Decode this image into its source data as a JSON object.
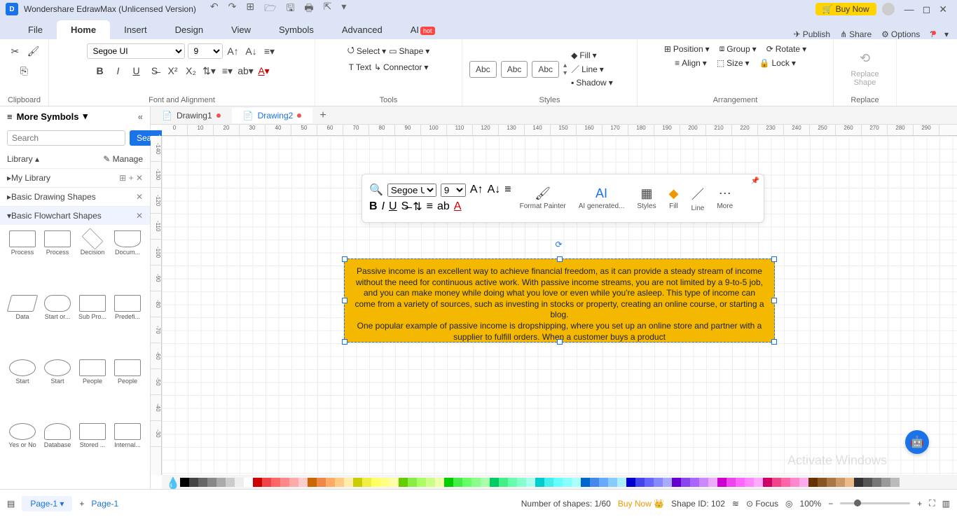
{
  "title": "Wondershare EdrawMax (Unlicensed Version)",
  "buyNow": "Buy Now",
  "menuTabs": [
    "File",
    "Home",
    "Insert",
    "Design",
    "View",
    "Symbols",
    "Advanced",
    "AI"
  ],
  "menuRight": {
    "publish": "Publish",
    "share": "Share",
    "options": "Options"
  },
  "ribbon": {
    "clipboard": "Clipboard",
    "fontAlign": "Font and Alignment",
    "tools": "Tools",
    "styles": "Styles",
    "arrangement": "Arrangement",
    "replace": "Replace",
    "font": "Segoe UI",
    "size": "9",
    "select": "Select",
    "shape": "Shape",
    "text": "Text",
    "connector": "Connector",
    "abc": "Abc",
    "fill": "Fill",
    "line": "Line",
    "shadow": "Shadow",
    "position": "Position",
    "group": "Group",
    "rotate": "Rotate",
    "align": "Align",
    "sizeBtn": "Size",
    "lock": "Lock",
    "replaceShape": "Replace\nShape"
  },
  "leftPanel": {
    "moreSymbols": "More Symbols",
    "searchPlaceholder": "Search",
    "searchBtn": "Search",
    "library": "Library",
    "manage": "Manage",
    "myLibrary": "My Library",
    "basicDrawing": "Basic Drawing Shapes",
    "basicFlowchart": "Basic Flowchart Shapes",
    "shapes": [
      "Process",
      "Process",
      "Decision",
      "Docum...",
      "Data",
      "Start or...",
      "Sub Pro...",
      "Predefi...",
      "Start",
      "Start",
      "People",
      "People",
      "Yes or No",
      "Database",
      "Stored ...",
      "Internal..."
    ]
  },
  "docTabs": {
    "d1": "Drawing1",
    "d2": "Drawing2"
  },
  "hruler": [
    0,
    10,
    20,
    30,
    40,
    50,
    60,
    70,
    80,
    90,
    100,
    110,
    120,
    130,
    140,
    150,
    160,
    170,
    180,
    190,
    200,
    210,
    220,
    230,
    240,
    250,
    260,
    270,
    280,
    290
  ],
  "vruler": [
    "-140",
    "-130",
    "-120",
    "-110",
    "-100",
    "-90",
    "-80",
    "-70",
    "-60",
    "-50",
    "-40",
    "-30"
  ],
  "shapeText": "Passive income is an excellent way to achieve financial freedom, as it can provide a steady stream of income without the need for continuous active work. With passive income streams, you are not limited by a 9-to-5 job, and you can make money while doing what you love or even while you're asleep. This type of income can come from a variety of sources, such as investing in stocks or property, creating an online course, or starting a blog.\nOne popular example of passive income is dropshipping, where you set up an online store and partner with a supplier to fulfill orders. When a customer buys a product",
  "floatbar": {
    "font": "Segoe UI",
    "size": "9",
    "formatPainter": "Format Painter",
    "aiGen": "AI generated...",
    "styles": "Styles",
    "fill": "Fill",
    "line": "Line",
    "more": "More"
  },
  "colors": [
    "#000",
    "#444",
    "#666",
    "#888",
    "#aaa",
    "#ccc",
    "#eee",
    "#fff",
    "#c00",
    "#e44",
    "#f66",
    "#f88",
    "#faa",
    "#fcc",
    "#c60",
    "#e84",
    "#fa6",
    "#fc8",
    "#fea",
    "#cc0",
    "#ee4",
    "#ff6",
    "#ff8",
    "#ffa",
    "#6c0",
    "#8e4",
    "#af6",
    "#cf8",
    "#efa",
    "#0c0",
    "#4e4",
    "#6f6",
    "#8f8",
    "#afa",
    "#0c6",
    "#4e8",
    "#6fa",
    "#8fc",
    "#afe",
    "#0cc",
    "#4ee",
    "#6ff",
    "#8ff",
    "#aff",
    "#06c",
    "#48e",
    "#6af",
    "#8cf",
    "#aef",
    "#00c",
    "#44e",
    "#66f",
    "#88f",
    "#aaf",
    "#60c",
    "#84e",
    "#a6f",
    "#c8f",
    "#eaf",
    "#c0c",
    "#e4e",
    "#f6f",
    "#f8f",
    "#faf",
    "#c06",
    "#e48",
    "#f6a",
    "#f8c",
    "#fae",
    "#630",
    "#852",
    "#a74",
    "#c96",
    "#eb8",
    "#333",
    "#555",
    "#777",
    "#999",
    "#bbb"
  ],
  "status": {
    "pageSel": "Page-1",
    "page": "Page-1",
    "numShapes": "Number of shapes: 1/60",
    "buyNow": "Buy Now",
    "shapeId": "Shape ID: 102",
    "focus": "Focus",
    "zoom": "100%"
  },
  "watermark": "Activate Windows"
}
